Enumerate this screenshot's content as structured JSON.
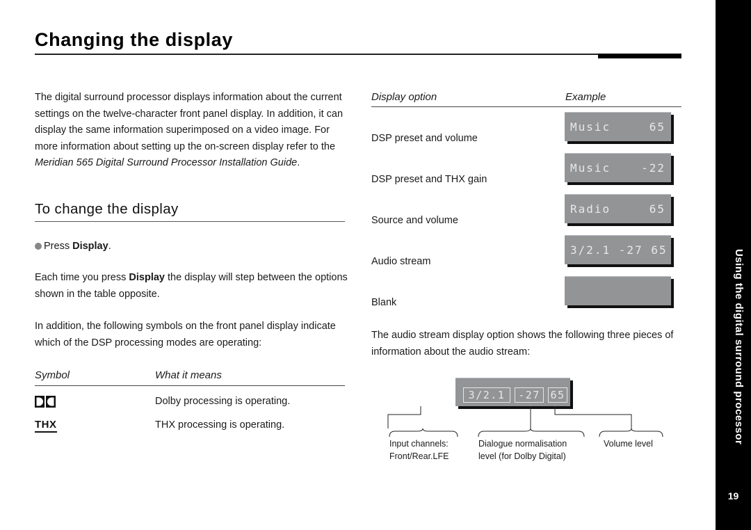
{
  "page": {
    "title": "Changing the display",
    "side_tab": "Using the digital surround processor",
    "page_number": "19"
  },
  "intro": {
    "text_before_italic": "The digital surround processor displays information about the current settings on the twelve-character front panel display. In addition, it can display the same information superimposed on a video image. For more information about setting up the on-screen display refer to the ",
    "italic": "Meridian 565 Digital Surround Processor Installation Guide",
    "text_after_italic": "."
  },
  "section": {
    "heading": "To change the display",
    "step_prefix": "Press ",
    "step_bold": "Display",
    "step_suffix": ".",
    "each_time_prefix": "Each time you press ",
    "each_time_bold": "Display",
    "each_time_suffix": " the display will step between the options shown in the table opposite.",
    "in_addition": "In addition, the following symbols on the front panel display indicate which of the DSP processing modes are operating:"
  },
  "symbols_table": {
    "headers": [
      "Symbol",
      "What it means"
    ],
    "rows": [
      {
        "icon": "dolby-double-d-icon",
        "meaning": "Dolby processing is operating."
      },
      {
        "icon": "thx-logo-icon",
        "symbol_text": "THX",
        "meaning": "THX processing is operating."
      }
    ]
  },
  "options_table": {
    "headers": [
      "Display option",
      "Example"
    ],
    "rows": [
      {
        "label": "DSP preset and volume",
        "left": "Music",
        "right": "65"
      },
      {
        "label": "DSP preset and THX gain",
        "left": "Music",
        "right": "-22"
      },
      {
        "label": "Source and volume",
        "left": "Radio",
        "right": "65"
      },
      {
        "label": "Audio stream",
        "left": "3/2.1 -27 65",
        "right": ""
      },
      {
        "label": "Blank",
        "left": "",
        "right": ""
      }
    ]
  },
  "audio_stream": {
    "note": "The audio stream display option shows the following three pieces of information about the audio stream:",
    "segments": [
      "3/2.1",
      "-27",
      "65"
    ],
    "labels": [
      {
        "line1": "Input channels:",
        "line2": "Front/Rear.LFE"
      },
      {
        "line1": "Dialogue normalisation",
        "line2": "level (for Dolby Digital)"
      },
      {
        "line1": "Volume level",
        "line2": ""
      }
    ]
  },
  "colors": {
    "lcd_background": "#939496",
    "lcd_text": "#e8e8e8",
    "side_tab": "#000000"
  }
}
